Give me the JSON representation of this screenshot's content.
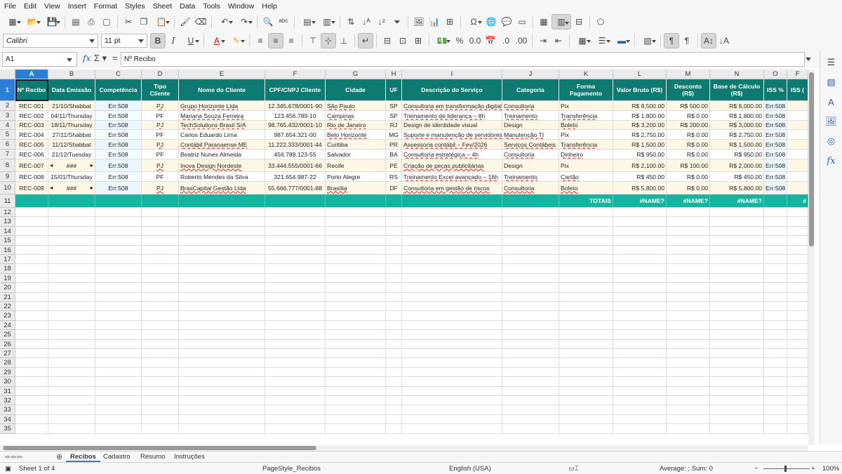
{
  "menu": [
    "File",
    "Edit",
    "View",
    "Insert",
    "Format",
    "Styles",
    "Sheet",
    "Data",
    "Tools",
    "Window",
    "Help"
  ],
  "format_bar": {
    "font_name": "Calibri",
    "font_size": "11 pt"
  },
  "name_box": "A1",
  "formula": "Nº Recibo",
  "columns": [
    "A",
    "B",
    "C",
    "D",
    "E",
    "F",
    "G",
    "H",
    "I",
    "J",
    "K",
    "L",
    "M",
    "N",
    "O",
    "F"
  ],
  "headers": [
    "Nº Recibo",
    "Data Emissão",
    "Competência",
    "Tipo Cliente",
    "Nome do Cliente",
    "CPF/CNPJ Cliente",
    "Cidade",
    "UF",
    "Descrição do Serviço",
    "Categoria",
    "Forma Pagamento",
    "Valor Bruto (R$)",
    "Desconto (R$)",
    "Base de Cálculo (R$)",
    "ISS %",
    "ISS ("
  ],
  "rows": [
    [
      "REC-001",
      "21/10/Shabbat",
      "Err:508",
      "PJ",
      "Grupo Horizonte Ltda",
      "12.345.678/0001-90",
      "São Paulo",
      "SP",
      "Consultoria em transformação digital",
      "Consultoria",
      "Pix",
      "R$ 8,500.00",
      "R$ 500.00",
      "R$ 8,000.00",
      "Err:508",
      ""
    ],
    [
      "REC-002",
      "04/11/Thursday",
      "Err:508",
      "PF",
      "Mariana Souza Ferreira",
      "123.456.789-10",
      "Campinas",
      "SP",
      "Treinamento de liderança – 8h",
      "Treinamento",
      "Transferência",
      "R$ 1,800.00",
      "R$ 0.00",
      "R$ 1,800.00",
      "Err:508",
      ""
    ],
    [
      "REC-003",
      "18/11/Thursday",
      "Err:508",
      "PJ",
      "TechSolutions Brasil S/A",
      "98.765.432/0001-10",
      "Rio de Janeiro",
      "RJ",
      "Design de identidade visual",
      "Design",
      "Boleto",
      "R$ 3,200.00",
      "R$ 200.00",
      "R$ 3,000.00",
      "Err:508",
      ""
    ],
    [
      "REC-004",
      "27/11/Shabbat",
      "Err:508",
      "PF",
      "Carlos Eduardo Lima",
      "987.654.321-00",
      "Belo Horizonte",
      "MG",
      "Suporte e manutenção de servidores",
      "Manutenção TI",
      "Pix",
      "R$ 2,750.00",
      "R$ 0.00",
      "R$ 2,750.00",
      "Err:508",
      ""
    ],
    [
      "REC-005",
      "11/12/Shabbat",
      "Err:508",
      "PJ",
      "Contábil Paranaense ME",
      "11.222.333/0001-44",
      "Curitiba",
      "PR",
      "Assessoria contábil – Fev/2026",
      "Serviços Contábeis",
      "Transferência",
      "R$ 1,500.00",
      "R$ 0.00",
      "R$ 1,500.00",
      "Err:508",
      ""
    ],
    [
      "REC-006",
      "21/12/Tuesday",
      "Err:508",
      "PF",
      "Beatriz Nunes Almeida",
      "456.789.123-55",
      "Salvador",
      "BA",
      "Consultoria estratégica – 4h",
      "Consultoria",
      "Dinheiro",
      "R$ 950.00",
      "R$ 0.00",
      "R$ 950.00",
      "Err:508",
      ""
    ],
    [
      "REC-007",
      "###",
      "Err:508",
      "PJ",
      "Inova Design Nordeste",
      "33.444.555/0001-66",
      "Recife",
      "PE",
      "Criação de peças publicitárias",
      "Design",
      "Pix",
      "R$ 2,100.00",
      "R$ 100.00",
      "R$ 2,000.00",
      "Err:508",
      ""
    ],
    [
      "REC-008",
      "15/01/Thursday",
      "Err:508",
      "PF",
      "Roberto Mendes da Silva",
      "321.654.987-22",
      "Porto Alegre",
      "RS",
      "Treinamento Excel avançado – 16h",
      "Treinamento",
      "Cartão",
      "R$ 450.00",
      "R$ 0.00",
      "R$ 450.00",
      "Err:508",
      ""
    ],
    [
      "REC-009",
      "###",
      "Err:508",
      "PJ",
      "BrasCapital Gestão Ltda",
      "55.666.777/0001-88",
      "Brasília",
      "DF",
      "Consultoria em gestão de riscos",
      "Consultoria",
      "Boleto",
      "R$ 5,800.00",
      "R$ 0.00",
      "R$ 5,800.00",
      "Err:508",
      ""
    ]
  ],
  "totals": {
    "label": "TOTAIS",
    "valor_bruto": "#NAME?",
    "desconto": "#NAME?",
    "base": "#NAME?",
    "p": "#"
  },
  "row_numbers": [
    "1",
    "2",
    "3",
    "4",
    "5",
    "6",
    "7",
    "8",
    "9",
    "10",
    "11",
    "12",
    "13",
    "14",
    "15",
    "16",
    "17",
    "18",
    "19",
    "20",
    "21",
    "22",
    "23",
    "24",
    "25",
    "26",
    "27",
    "28",
    "29",
    "30",
    "31",
    "32",
    "33",
    "34",
    "35"
  ],
  "sheet_tabs": [
    "Recibos",
    "Cadastro",
    "Resumo",
    "Instruções"
  ],
  "status": {
    "sheet": "Sheet 1 of 4",
    "page_style": "PageStyle_Recibos",
    "language": "English (USA)",
    "summary": "Average: ; Sum: 0",
    "zoom": "100%"
  },
  "colors": {
    "header_bg": "#0f7a72",
    "totals_bg": "#15b3a2",
    "selection": "#2b7fd6"
  }
}
